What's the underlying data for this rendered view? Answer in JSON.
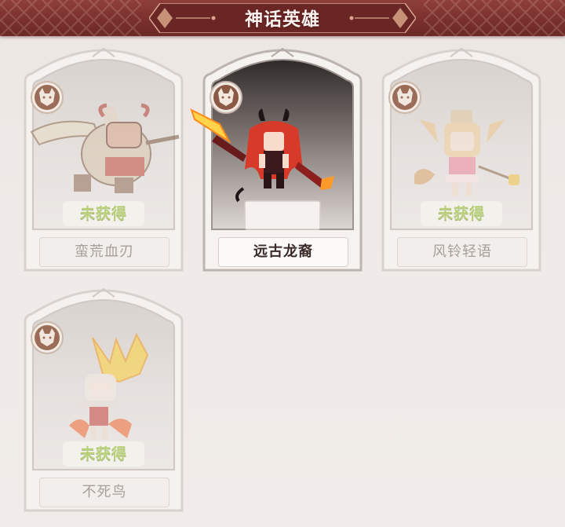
{
  "header": {
    "title": "神话英雄"
  },
  "heroes": [
    {
      "name": "蛮荒血刃",
      "status": "未获得",
      "owned": false,
      "icon": "barbarian-sprite"
    },
    {
      "name": "远古龙裔",
      "status": "",
      "owned": true,
      "icon": "dragon-girl-sprite"
    },
    {
      "name": "风铃轻语",
      "status": "未获得",
      "owned": false,
      "icon": "fox-girl-sprite"
    },
    {
      "name": "不死鸟",
      "status": "未获得",
      "owned": false,
      "icon": "phoenix-sprite"
    }
  ],
  "colors": {
    "banner": "#7a302d",
    "locked_text": "#b9cf7a",
    "badge": "#8a5a45"
  }
}
